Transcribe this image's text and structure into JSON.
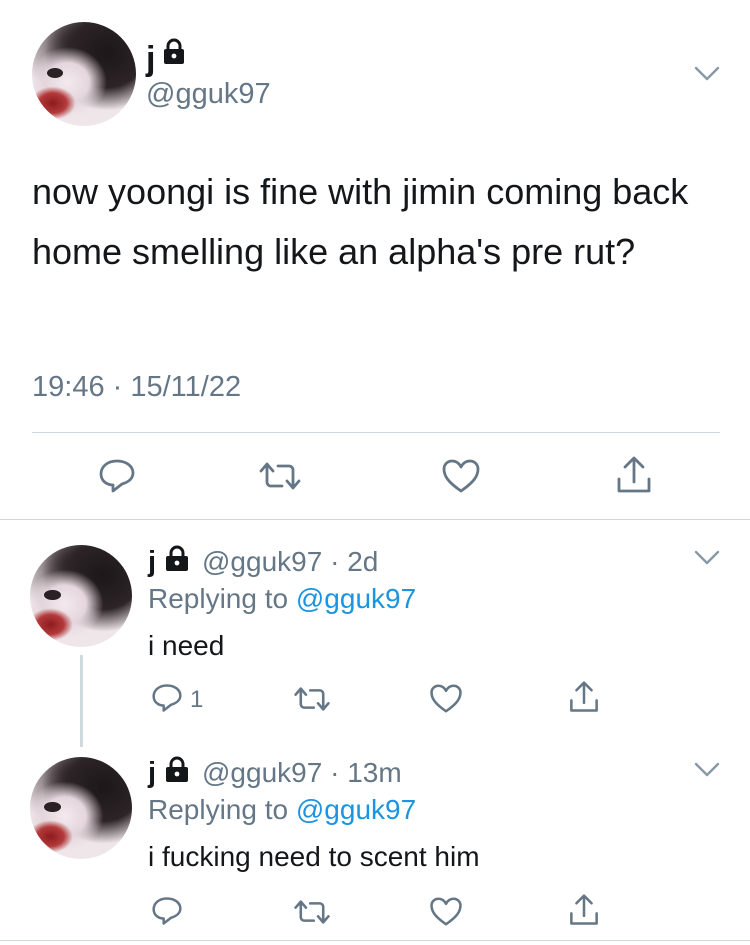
{
  "tweet": {
    "name": "j",
    "handle": "@gguk97",
    "text": "now yoongi is fine with jimin coming back home smelling like an alpha's pre rut?",
    "timestamp": "19:46 · 15/11/22"
  },
  "replies": [
    {
      "name": "j",
      "handle": "@gguk97",
      "separator": "·",
      "time": "2d",
      "replying_prefix": "Replying to",
      "replying_to": "@gguk97",
      "text": "i need",
      "reply_count": "1"
    },
    {
      "name": "j",
      "handle": "@gguk97",
      "separator": "·",
      "time": "13m",
      "replying_prefix": "Replying to",
      "replying_to": "@gguk97",
      "text": "i fucking need to scent him",
      "reply_count": ""
    }
  ],
  "icons": {
    "lock": "lock-icon",
    "chevron": "chevron-down-icon",
    "reply": "reply-icon",
    "retweet": "retweet-icon",
    "like": "heart-icon",
    "share": "share-icon"
  },
  "colors": {
    "text": "#14171a",
    "secondary": "#657786",
    "link": "#1b95e0",
    "divider": "#cfd6dc"
  }
}
